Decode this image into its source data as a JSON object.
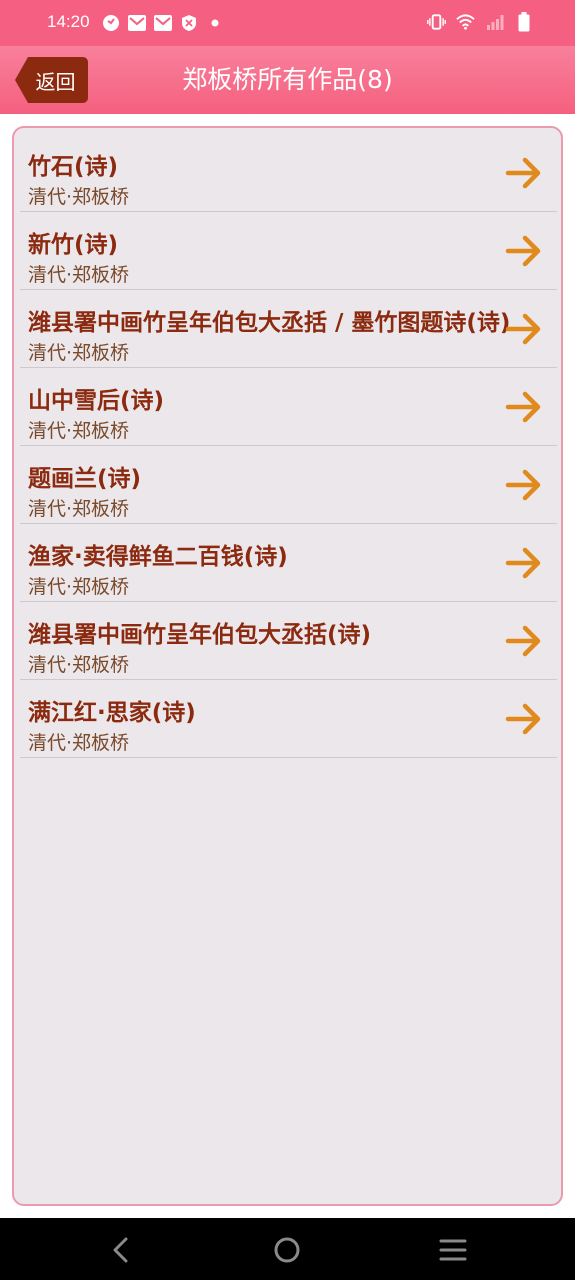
{
  "status_bar": {
    "time": "14:20",
    "left_icons": [
      "help-circle-icon",
      "mail-icon",
      "mail-icon",
      "shield-icon",
      "dot-icon"
    ],
    "right_icons": [
      "vibrate-icon",
      "wifi-icon",
      "signal-icon",
      "battery-icon"
    ]
  },
  "header": {
    "back_label": "返回",
    "title": "郑板桥所有作品(8)"
  },
  "works": [
    {
      "title": "竹石(诗)",
      "author": "清代·郑板桥"
    },
    {
      "title": "新竹(诗)",
      "author": "清代·郑板桥"
    },
    {
      "title": "潍县署中画竹呈年伯包大丞括 / 墨竹图题诗(诗)",
      "author": "清代·郑板桥"
    },
    {
      "title": "山中雪后(诗)",
      "author": "清代·郑板桥"
    },
    {
      "title": "题画兰(诗)",
      "author": "清代·郑板桥"
    },
    {
      "title": "渔家·卖得鲜鱼二百钱(诗)",
      "author": "清代·郑板桥"
    },
    {
      "title": "潍县署中画竹呈年伯包大丞括(诗)",
      "author": "清代·郑板桥"
    },
    {
      "title": "满江红·思家(诗)",
      "author": "清代·郑板桥"
    }
  ],
  "colors": {
    "accent": "#f45f82",
    "back_button": "#8c2a10",
    "title_text": "#8c2a10",
    "arrow": "#e08a1e"
  },
  "nav": {
    "icons": [
      "back-icon",
      "home-icon",
      "menu-icon"
    ]
  }
}
